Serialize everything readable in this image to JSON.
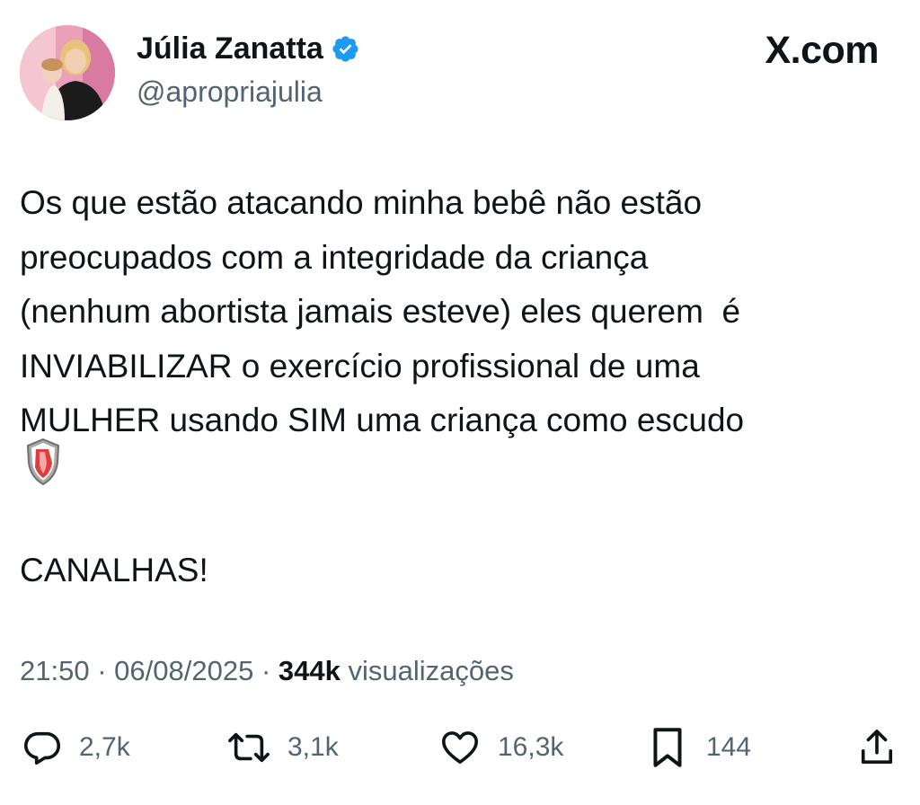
{
  "header": {
    "display_name": "Júlia Zanatta",
    "handle": "@apropriajulia",
    "brand": "X.com",
    "verified_icon": "verified-badge-icon",
    "verified_color": "#1d9bf0"
  },
  "tweet": {
    "lines": [
      "Os que estão atacando minha bebê não estão",
      "preocupados com a integridade da criança",
      "(nenhum abortista jamais esteve) eles querem  é",
      "INVIABILIZAR o exercício profissional de uma",
      "MULHER usando SIM uma criança como escudo"
    ],
    "emoji": "shield-emoji",
    "closing": "CANALHAS!"
  },
  "meta": {
    "time": "21:50",
    "date": "06/08/2025",
    "views_count": "344k",
    "views_label": "visualizações",
    "separator": "·"
  },
  "actions": {
    "replies": {
      "icon": "reply-icon",
      "count": "2,7k"
    },
    "reposts": {
      "icon": "repost-icon",
      "count": "3,1k"
    },
    "likes": {
      "icon": "like-icon",
      "count": "16,3k"
    },
    "bookmarks": {
      "icon": "bookmark-icon",
      "count": "144"
    },
    "share": {
      "icon": "share-icon"
    }
  },
  "colors": {
    "text": "#0f1419",
    "secondary": "#536471",
    "accent": "#1d9bf0"
  }
}
